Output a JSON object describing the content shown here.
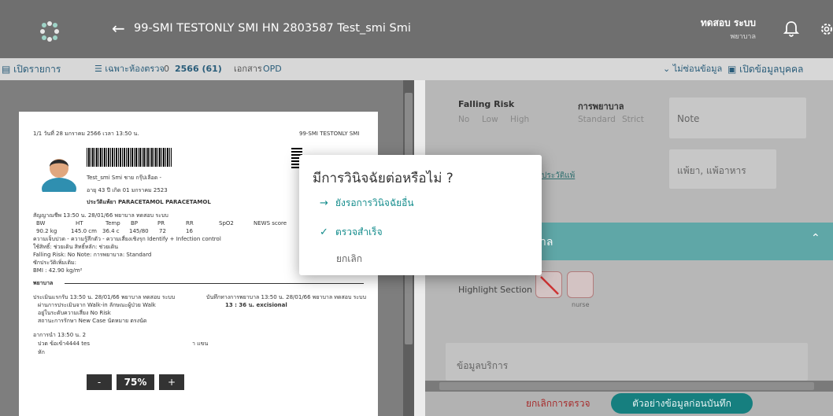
{
  "header": {
    "title": "99-SMI TESTONLY SMI    HN 2803587 Test_smi Smi",
    "user_name": "ทดสอบ ระบบ",
    "user_role": "พยาบาล"
  },
  "toolbar": {
    "open_list": "เปิดรายการ",
    "filter": "เฉพาะห้องตรวจ",
    "visit_no": "0",
    "visit_year": "2566 (61)",
    "doc_label": "เอกสาร",
    "doc_value": "OPD",
    "show_info": "ไม่ซ่อนข้อมูล",
    "open_person": "เปิดข้อมูลบุคคล"
  },
  "document": {
    "page_info": "1/1  วันที่ 28 มกราคม 2566  เวลา 13:50 น.",
    "site": "99-SMI TESTONLY SMI",
    "patient_line": "Test_smi Smi  ชาย  กรุ๊ปเลือด -",
    "age_line": "อายุ 43 ปี  เกิด 01 มกราคม 2523",
    "allergy_line": "ประวัติแพ้ยา PARACETAMOL PARACETAMOL",
    "vitals_header": "สัญญาณชีพ  13:50 น. 28/01/66 พยาบาล ทดสอบ ระบบ",
    "vitals_cols": [
      "BW",
      "HT",
      "Temp",
      "BP",
      "PR",
      "RR",
      "SpO2",
      "NEWS score"
    ],
    "vitals_vals": [
      "90.2 kg",
      "145.0 cm",
      "36.4 c",
      "145/80",
      "72",
      "16"
    ],
    "line_pain": "ความเจ็บปวด -  ความรู้สึกตัว -  ความเสี่ยงเชิงรุก Identify + Infection control",
    "line_mobility": "ใช้สิทธิ์: ช่วยเดิน  สิทธิ์หลัก: ช่วยเดิน",
    "falling_line": "Falling Risk:      No        Note:                           การพยาบาล: Standard",
    "line_history": "ซักประวัติเพิ่มเติม:",
    "bmi": "BMI : 42.90 kg/m²",
    "nurse_head": "พยาบาล",
    "assess_head": "ประเมินแรกรับ  13:50 น. 28/01/66 พยาบาล ทดสอบ ระบบ",
    "assess_l1": "ผ่านการประเมินจาก Walk-in  ลักษณะผู้ป่วย Walk",
    "assess_l2": "อยู่ในระดับความเสี่ยง No Risk",
    "assess_l3": "สถานะการรักษา New Case  นัดหมาย ตรงนัด",
    "note_head": "บันทึกทางการพยาบาล  13:50 น. 28/01/66 พยาบาล ทดสอบ ระบบ",
    "note_time": "13 : 36 น.  excisional",
    "cc_head": "อาการนำ 13:50 น. 2",
    "cc_l1": "ปวด ข้อเข้า4444 tes",
    "cc_l1b": "า แขน",
    "cc_l2": "หัก"
  },
  "zoom": {
    "minus": "-",
    "value": "75%",
    "plus": "+"
  },
  "right_panel": {
    "falling_risk_label": "Falling Risk",
    "falling_opts": [
      "No",
      "Low",
      "High"
    ],
    "nursing_label": "การพยาบาล",
    "nursing_opts": [
      "Standard",
      "Strict"
    ],
    "note_placeholder": "Note",
    "allergy_link": "ประวัติแพ้",
    "allergy_placeholder": "แพ้ยา, แพ้อาหาร",
    "section_title": "าล",
    "highlight_label": "Highlight Section",
    "nurse_caption": "nurse",
    "service_placeholder": "ข้อมูลบริการ",
    "cancel_exam": "ยกเลิกการตรวจ",
    "preview_save": "ตัวอย่างข้อมูลก่อนบันทึก"
  },
  "modal": {
    "title": "มีการวินิจฉัยต่อหรือไม่ ?",
    "opt_wait": "ยังรอการวินิจฉัยอื่น",
    "opt_done": "ตรวจสำเร็จ",
    "opt_cancel": "ยกเลิก"
  },
  "colors": {
    "teal": "#138c8c",
    "header": "#6f6f6f",
    "section": "#5fa7a7"
  }
}
